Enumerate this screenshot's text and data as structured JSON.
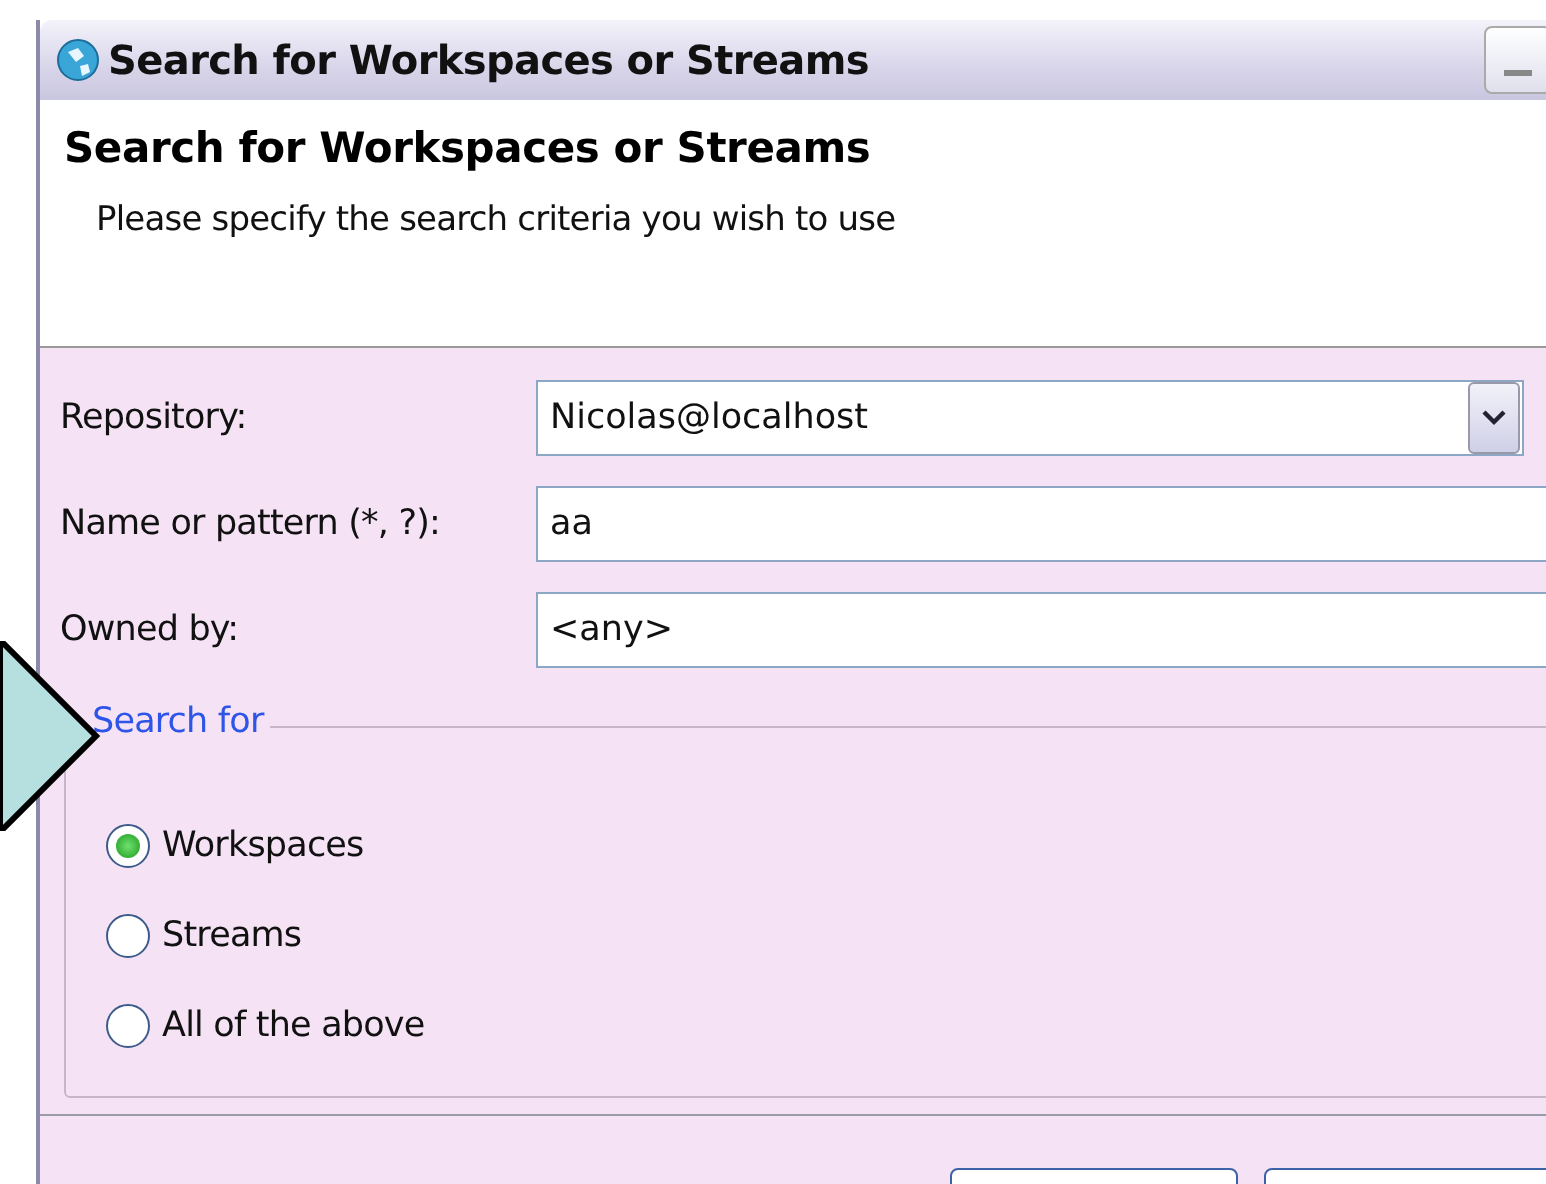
{
  "window": {
    "title": "Search for Workspaces or Streams"
  },
  "header": {
    "title": "Search for Workspaces or Streams",
    "description": "Please specify the search criteria you wish to use"
  },
  "fields": [
    {
      "kind": "combo",
      "label": "Repository:",
      "value": "Nicolas@localhost"
    },
    {
      "kind": "text",
      "label": "Name or pattern (*, ?):",
      "value": "aa"
    },
    {
      "kind": "text",
      "label": "Owned by:",
      "value": "<any>"
    }
  ],
  "search_for": {
    "legend": "Search for",
    "options": [
      {
        "label": "Workspaces",
        "selected": true
      },
      {
        "label": "Streams",
        "selected": false
      },
      {
        "label": "All of the above",
        "selected": false
      }
    ]
  }
}
